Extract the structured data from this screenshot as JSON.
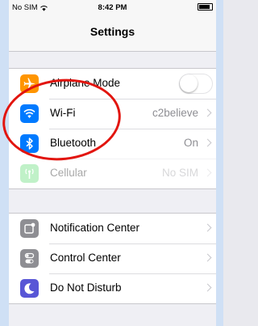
{
  "status_bar": {
    "carrier": "No SIM",
    "time": "8:42 PM",
    "battery_level": 0.9
  },
  "nav": {
    "title": "Settings"
  },
  "groups": [
    {
      "rows": [
        {
          "label": "Airplane Mode",
          "icon": "airplane-icon",
          "icon_color": "#ff9500",
          "control": "toggle",
          "toggle_on": false
        },
        {
          "label": "Wi-Fi",
          "icon": "wifi-icon",
          "icon_color": "#007aff",
          "value": "c2believe"
        },
        {
          "label": "Bluetooth",
          "icon": "bluetooth-icon",
          "icon_color": "#007aff",
          "value": "On"
        },
        {
          "label": "Cellular",
          "icon": "cellular-icon",
          "icon_color": "#4cd964",
          "value": "No SIM",
          "disabled": true
        }
      ]
    },
    {
      "rows": [
        {
          "label": "Notification Center",
          "icon": "notification-center-icon",
          "icon_color": "#8e8e93"
        },
        {
          "label": "Control Center",
          "icon": "control-center-icon",
          "icon_color": "#8e8e93"
        },
        {
          "label": "Do Not Disturb",
          "icon": "moon-icon",
          "icon_color": "#5856d6"
        }
      ]
    }
  ],
  "annotation": {
    "shape": "ellipse",
    "color": "#e2150f"
  }
}
